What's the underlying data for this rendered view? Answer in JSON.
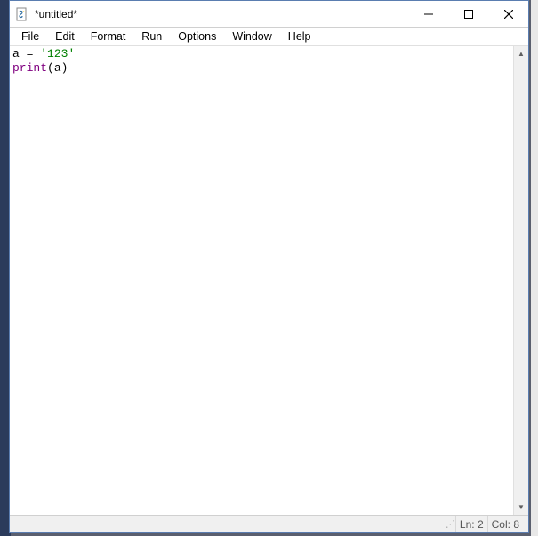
{
  "window": {
    "title": "*untitled*"
  },
  "menu": {
    "file": "File",
    "edit": "Edit",
    "format": "Format",
    "run": "Run",
    "options": "Options",
    "window": "Window",
    "help": "Help"
  },
  "code": {
    "line1": {
      "var": "a",
      "sp1": " ",
      "op": "=",
      "sp2": " ",
      "str": "'123'"
    },
    "line2": {
      "builtin": "print",
      "lp": "(",
      "arg": "a",
      "rp": ")"
    }
  },
  "status": {
    "ln_label": "Ln:",
    "ln_value": "2",
    "col_label": "Col:",
    "col_value": "8"
  }
}
